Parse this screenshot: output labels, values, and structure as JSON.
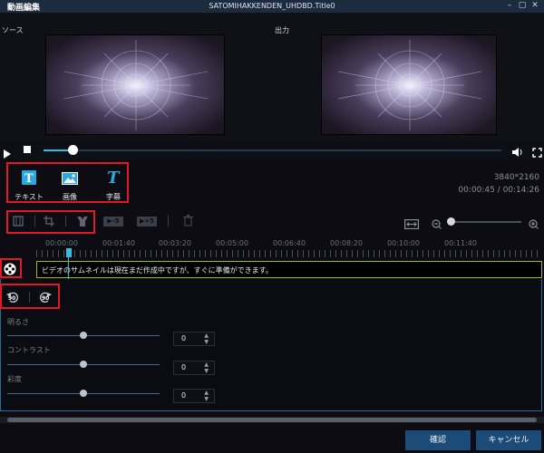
{
  "window": {
    "app_title": "動画編集",
    "title": "SATOMIHAKKENDEN_UHDBD.Title0",
    "controls": [
      "minimize-icon",
      "maximize-icon",
      "close-icon"
    ]
  },
  "preview": {
    "source_label": "ソース",
    "output_label": "出力"
  },
  "playback": {
    "play_icon": "play-icon",
    "stop_icon": "stop-icon",
    "volume_icon": "volume-icon",
    "fullscreen_icon": "fullscreen-icon",
    "progress": 0.06
  },
  "tools": {
    "text_label": "テキスト",
    "image_label": "画像",
    "subtitle_label": "字幕",
    "resolution": "3840*2160",
    "time": "00:00:45 / 00:14:26"
  },
  "timeline_toolbar": {
    "skip_back_label": "▶-5",
    "skip_forward_label": "▶+5",
    "zoom_level": 0.0
  },
  "ruler": {
    "ticks": [
      "00:00:00",
      "00:01:40",
      "00:03:20",
      "00:05:00",
      "00:06:40",
      "00:08:20",
      "00:10:00",
      "00:11:40"
    ]
  },
  "clip": {
    "message": "ビデオのサムネイルは現在まだ作成中ですが、すぐに準備ができます。"
  },
  "adjust": {
    "rotate_left_label": "90",
    "rotate_right_label": "90",
    "brightness_label": "明るさ",
    "brightness_value": "0",
    "contrast_label": "コントラスト",
    "contrast_value": "0",
    "saturation_label": "彩度",
    "saturation_value": "0"
  },
  "buttons": {
    "confirm": "確認",
    "cancel": "キャンセル"
  },
  "colors": {
    "accent": "#2fbfe3",
    "highlight_red": "#e0182a",
    "button_blue": "#1d4b78"
  }
}
